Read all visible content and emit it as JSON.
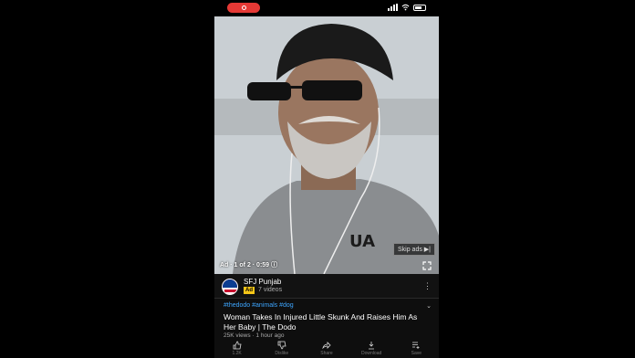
{
  "status_bar": {
    "recording_icon": "record-icon"
  },
  "video": {
    "ad_label": "Ad · 1 of 2 · 0:59 ⓘ",
    "skip_label": "Skip ads ▶|",
    "fullscreen_icon": "fullscreen-icon"
  },
  "channel": {
    "name": "SFJ Punjab",
    "ad_badge": "Ad",
    "video_count": "7 videos"
  },
  "info": {
    "hashtags": "#thedodo #animals #dog",
    "title": "Woman Takes In Injured Little Skunk And Raises Him As Her Baby | The Dodo",
    "meta": "25K views · 1 hour ago"
  },
  "actions": [
    {
      "icon": "thumbs-up-icon",
      "label": "1.2K"
    },
    {
      "icon": "thumbs-down-icon",
      "label": "Dislike"
    },
    {
      "icon": "share-icon",
      "label": "Share"
    },
    {
      "icon": "download-icon",
      "label": "Download"
    },
    {
      "icon": "save-icon",
      "label": "Save"
    }
  ],
  "colors": {
    "accent_link": "#3ea6ff",
    "record": "#e53935",
    "ad_badge": "#f5c518"
  }
}
